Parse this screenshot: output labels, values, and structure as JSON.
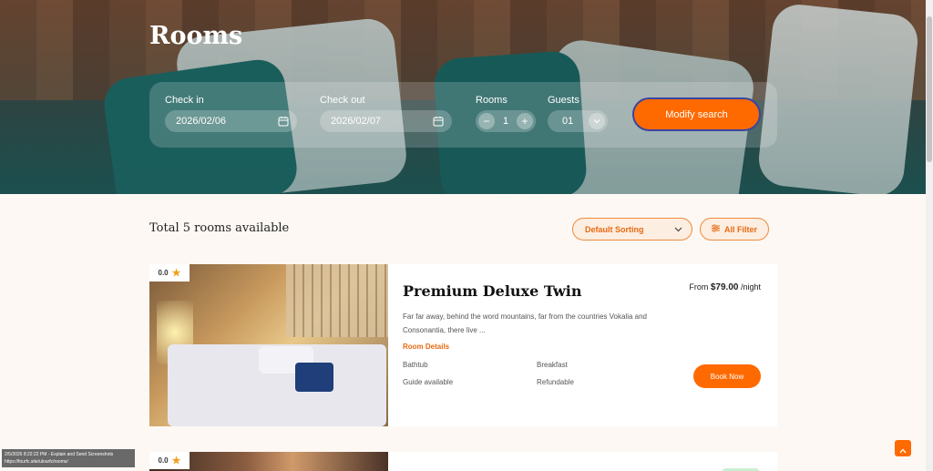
{
  "header": {
    "title": "Rooms"
  },
  "search": {
    "check_in_label": "Check in",
    "check_in_value": "2026/02/06",
    "check_out_label": "Check out",
    "check_out_value": "2026/02/07",
    "rooms_label": "Rooms",
    "rooms_value": "1",
    "guests_label": "Guests",
    "guests_value": "01",
    "modify_label": "Modify search"
  },
  "listing": {
    "total_text": "Total 5 rooms available",
    "sort_selected": "Default Sorting",
    "filter_label": "All Filter"
  },
  "rooms": [
    {
      "rating": "0.0",
      "title": "Premium Deluxe Twin",
      "price_prefix": "From",
      "price": "$79.00",
      "price_suffix": "/night",
      "description": "Far far away, behind the word mountains, far from the countries Vokalia and Consonantia, there live ...",
      "details_title": "Room Details",
      "amenities": [
        "Bathtub",
        "Breakfast",
        "Guide available",
        "Refundable"
      ],
      "book_label": "Book Now"
    },
    {
      "rating": "0.0"
    }
  ],
  "status_tip": {
    "line1": "2/5/2026 8:22:22 PM - Explain and Send Screenshots",
    "line2": "https://fourfc.site/ulourfc/rooms/"
  },
  "colors": {
    "accent": "#ff6a00",
    "accent_text": "#e86a10"
  }
}
